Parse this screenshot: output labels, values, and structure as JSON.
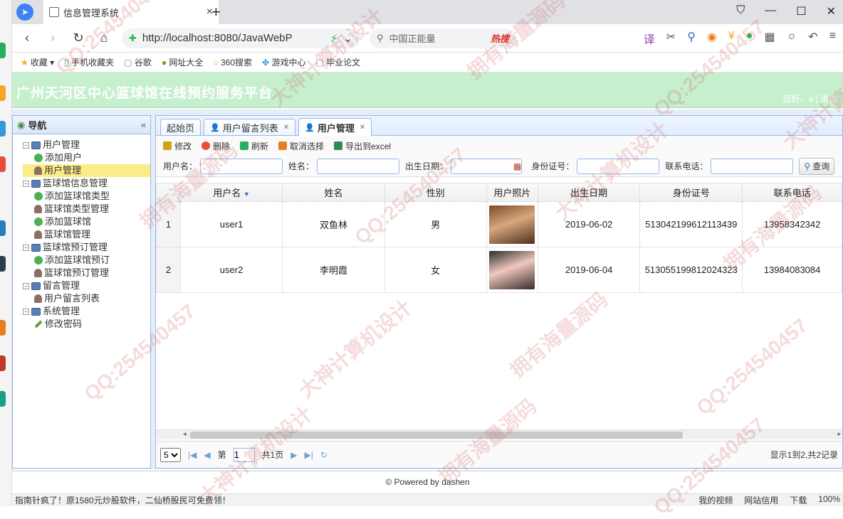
{
  "browser": {
    "tab_title": "信息管理系统",
    "url": "http://localhost:8080/JavaWebP",
    "search_placeholder": "中国正能量",
    "search_hot": "热搜",
    "bookmarks": [
      "收藏",
      "手机收藏夹",
      "谷歌",
      "网址大全",
      "360搜索",
      "游戏中心",
      "毕业论文"
    ]
  },
  "app": {
    "title": "广州天河区中心篮球馆在线预约服务平台",
    "welcome": "您好，a | 退出",
    "nav_title": "导航",
    "tree": [
      {
        "label": "用户管理",
        "level": 1
      },
      {
        "label": "添加用户",
        "level": 2,
        "icon": "add"
      },
      {
        "label": "用户管理",
        "level": 2,
        "icon": "user",
        "selected": true
      },
      {
        "label": "篮球馆信息管理",
        "level": 1
      },
      {
        "label": "添加篮球馆类型",
        "level": 2,
        "icon": "add"
      },
      {
        "label": "篮球馆类型管理",
        "level": 2,
        "icon": "user"
      },
      {
        "label": "添加篮球馆",
        "level": 2,
        "icon": "add"
      },
      {
        "label": "篮球馆管理",
        "level": 2,
        "icon": "user"
      },
      {
        "label": "篮球馆预订管理",
        "level": 1
      },
      {
        "label": "添加篮球馆预订",
        "level": 2,
        "icon": "add"
      },
      {
        "label": "篮球馆预订管理",
        "level": 2,
        "icon": "user"
      },
      {
        "label": "留言管理",
        "level": 1
      },
      {
        "label": "用户留言列表",
        "level": 2,
        "icon": "user"
      },
      {
        "label": "系统管理",
        "level": 1
      },
      {
        "label": "修改密码",
        "level": 2,
        "icon": "pen"
      }
    ],
    "tabs": [
      {
        "label": "起始页",
        "closable": false
      },
      {
        "label": "用户留言列表",
        "closable": true
      },
      {
        "label": "用户管理",
        "closable": true,
        "active": true
      }
    ],
    "toolbar": [
      "修改",
      "删除",
      "刷新",
      "取消选择",
      "导出到excel"
    ],
    "search_labels": [
      "用户名：",
      "姓名：",
      "出生日期：",
      "身份证号：",
      "联系电话："
    ],
    "query_button": "查询",
    "columns": [
      "用户名",
      "姓名",
      "性别",
      "用户照片",
      "出生日期",
      "身份证号",
      "联系电话"
    ],
    "rows": [
      {
        "num": "1",
        "username": "user1",
        "name": "双鱼林",
        "gender": "男",
        "birth": "2019-06-02",
        "idcard": "513042199612113439",
        "phone": "13958342342"
      },
      {
        "num": "2",
        "username": "user2",
        "name": "李明霞",
        "gender": "女",
        "birth": "2019-06-04",
        "idcard": "513055199812024323",
        "phone": "13984083084"
      }
    ],
    "pager": {
      "page_size": "5",
      "page_label": "第",
      "page_num": "1",
      "total_pages": "共1页",
      "summary": "显示1到2,共2记录"
    },
    "footer": "© Powered by dashen"
  },
  "statusbar": {
    "news": "指南针疯了！原1580元炒股软件，二仙桥股民可免费领！",
    "items": [
      "我的视频",
      "网站信用",
      "下载",
      "100%"
    ]
  },
  "watermarks": [
    "QQ:254540457",
    "大神计算机设计",
    "拥有海量源码"
  ]
}
